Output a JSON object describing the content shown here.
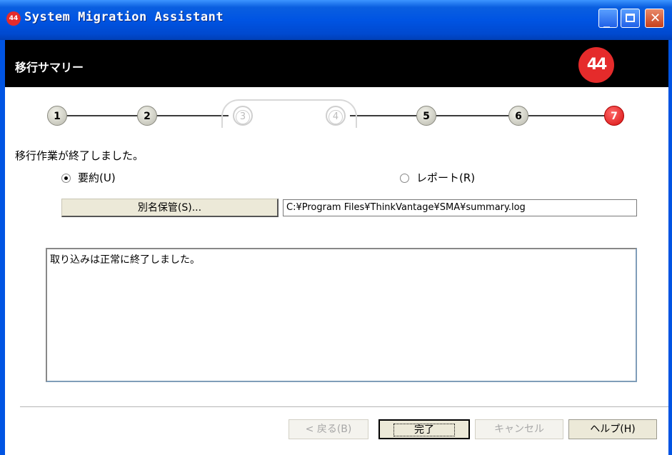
{
  "window": {
    "title": "System Migration Assistant",
    "icon": "sma-logo-icon",
    "controls": [
      "minimize-icon",
      "maximize-icon",
      "close-icon"
    ]
  },
  "header": {
    "title": "移行サマリー",
    "logo": "sma-logo-icon"
  },
  "steps": [
    {
      "label": "1",
      "state": "done"
    },
    {
      "label": "2",
      "state": "done"
    },
    {
      "label": "3",
      "state": "skipped"
    },
    {
      "label": "4",
      "state": "skipped"
    },
    {
      "label": "5",
      "state": "done"
    },
    {
      "label": "6",
      "state": "done"
    },
    {
      "label": "7",
      "state": "current"
    }
  ],
  "main": {
    "message": "移行作業が終了しました。",
    "radio_summary": "要約(U)",
    "radio_report": "レポート(R)",
    "selected": "summary",
    "save_as_label": "別名保管(S)...",
    "path_value": "C:¥Program Files¥ThinkVantage¥SMA¥summary.log",
    "log_text": "取り込みは正常に終了しました。"
  },
  "footer": {
    "back_label": "< 戻る(B)",
    "finish_label": "完了",
    "cancel_label": "キャンセル",
    "help_label": "ヘルプ(H)"
  },
  "colors": {
    "titlebar": "#0054e3",
    "header_bg": "#000000",
    "accent_red": "#e52b2b"
  }
}
